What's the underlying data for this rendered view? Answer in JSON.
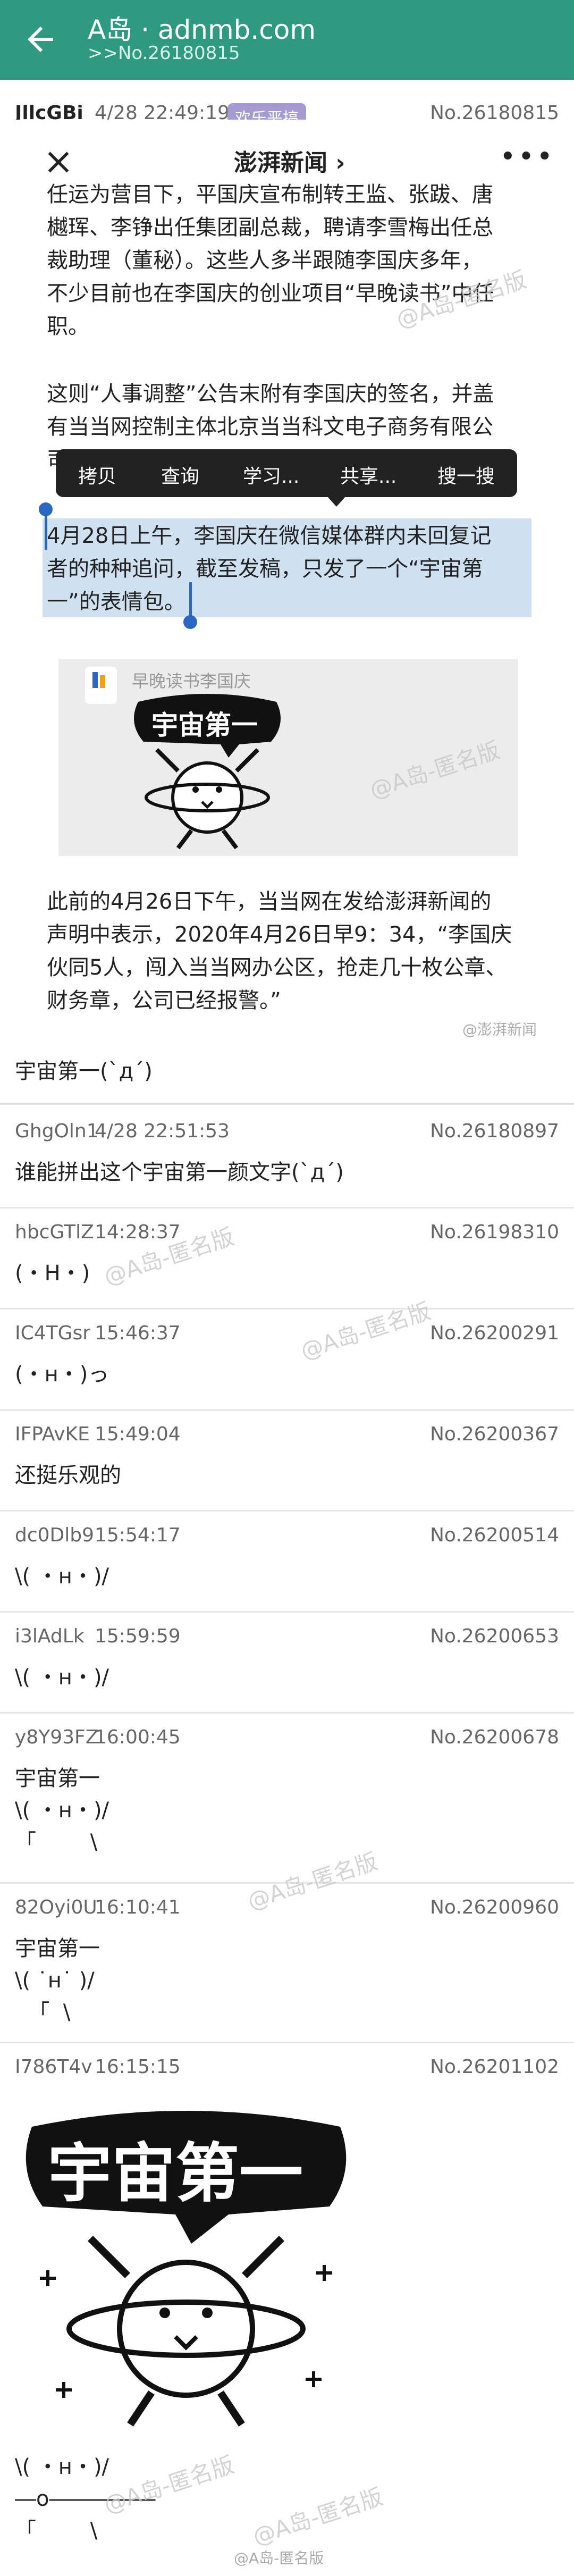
{
  "appbar": {
    "title": "A岛 · adnmb.com",
    "subtitle": ">>No.26180815"
  },
  "main_post": {
    "uid": "JllcGBi",
    "time": "4/28 22:49:19",
    "badge": "欢乐恶搞",
    "number": "No.26180815"
  },
  "embedded": {
    "news_title": "澎湃新闻 ›",
    "para1": "任运为营目下，平国庆宣布制转王监、张跋、唐\n樾珲、李铮出任集团副总裁，聘请李雪梅出任总\n裁助理（董秘）。这些人多半跟随李国庆多年，\n不少目前也在李国庆的创业项目“早晚读书”中任\n职。",
    "para2": "这则“人事调整”公告末附有李国庆的签名，并盖\n有当当网控制主体北京当当科文电子商务有限公\n司",
    "menu": [
      "拷贝",
      "查询",
      "学习...",
      "共享...",
      "搜一搜"
    ],
    "selected": "4月28日上午，李国庆在微信媒体群内未回复记\n者的种种追问，截至发稿，只发了一个“宇宙第\n一”的表情包。",
    "sticker_source": "早晚读书李国庆",
    "sticker_text": "宇宙第一",
    "para3": "此前的4月26日下午，当当网在发给澎湃新闻的\n声明中表示，2020年4月26日早9：34，“李国庆\n伙同5人，闯入当当网办公区，抢走几十枚公章、\n财务章，公司已经报警。”",
    "watermark": "@A岛-匿名版",
    "credit": "@澎湃新闻"
  },
  "main_post_text": "宇宙第一(`д´)",
  "replies": [
    {
      "uid": "GhgOln1",
      "time": "4/28 22:51:53",
      "number": "No.26180897",
      "text": "谁能拼出这个宇宙第一颜文字(`д´)"
    },
    {
      "uid": "hbcGTlZ",
      "time": "14:28:37",
      "number": "No.26198310",
      "text": "(・H・)"
    },
    {
      "uid": "IC4TGsr",
      "time": "15:46:37",
      "number": "No.26200291",
      "text": "(・н・)っ"
    },
    {
      "uid": "IFPAvKE",
      "time": "15:49:04",
      "number": "No.26200367",
      "text": "还挺乐观的"
    },
    {
      "uid": "dc0Dlb9",
      "time": "15:54:17",
      "number": "No.26200514",
      "text": "\\( ・н・)/"
    },
    {
      "uid": "i3lAdLk",
      "time": "15:59:59",
      "number": "No.26200653",
      "text": "\\( ・н・)/"
    },
    {
      "uid": "y8Y93FZ",
      "time": "16:00:45",
      "number": "No.26200678",
      "text": "宇宙第一\n\\( ・н・)/\n「        \\"
    },
    {
      "uid": "82Oyi0U",
      "time": "16:10:41",
      "number": "No.26200960",
      "text": "宇宙第一\n\\( ˙н˙ )/\n  「  \\"
    },
    {
      "uid": "I786T4v",
      "time": "16:15:15",
      "number": "No.26201102",
      "text": "\\( ・н・)/\n―o―――――\n「        \\"
    }
  ],
  "last_sticker_text": "宇宙第一",
  "footer_watermark": "@A岛-匿名版",
  "colors": {
    "appbar": "#2f9a7f",
    "badge": "#a59bd1",
    "selection": "#cfe0f0",
    "handle": "#2a67c0"
  }
}
